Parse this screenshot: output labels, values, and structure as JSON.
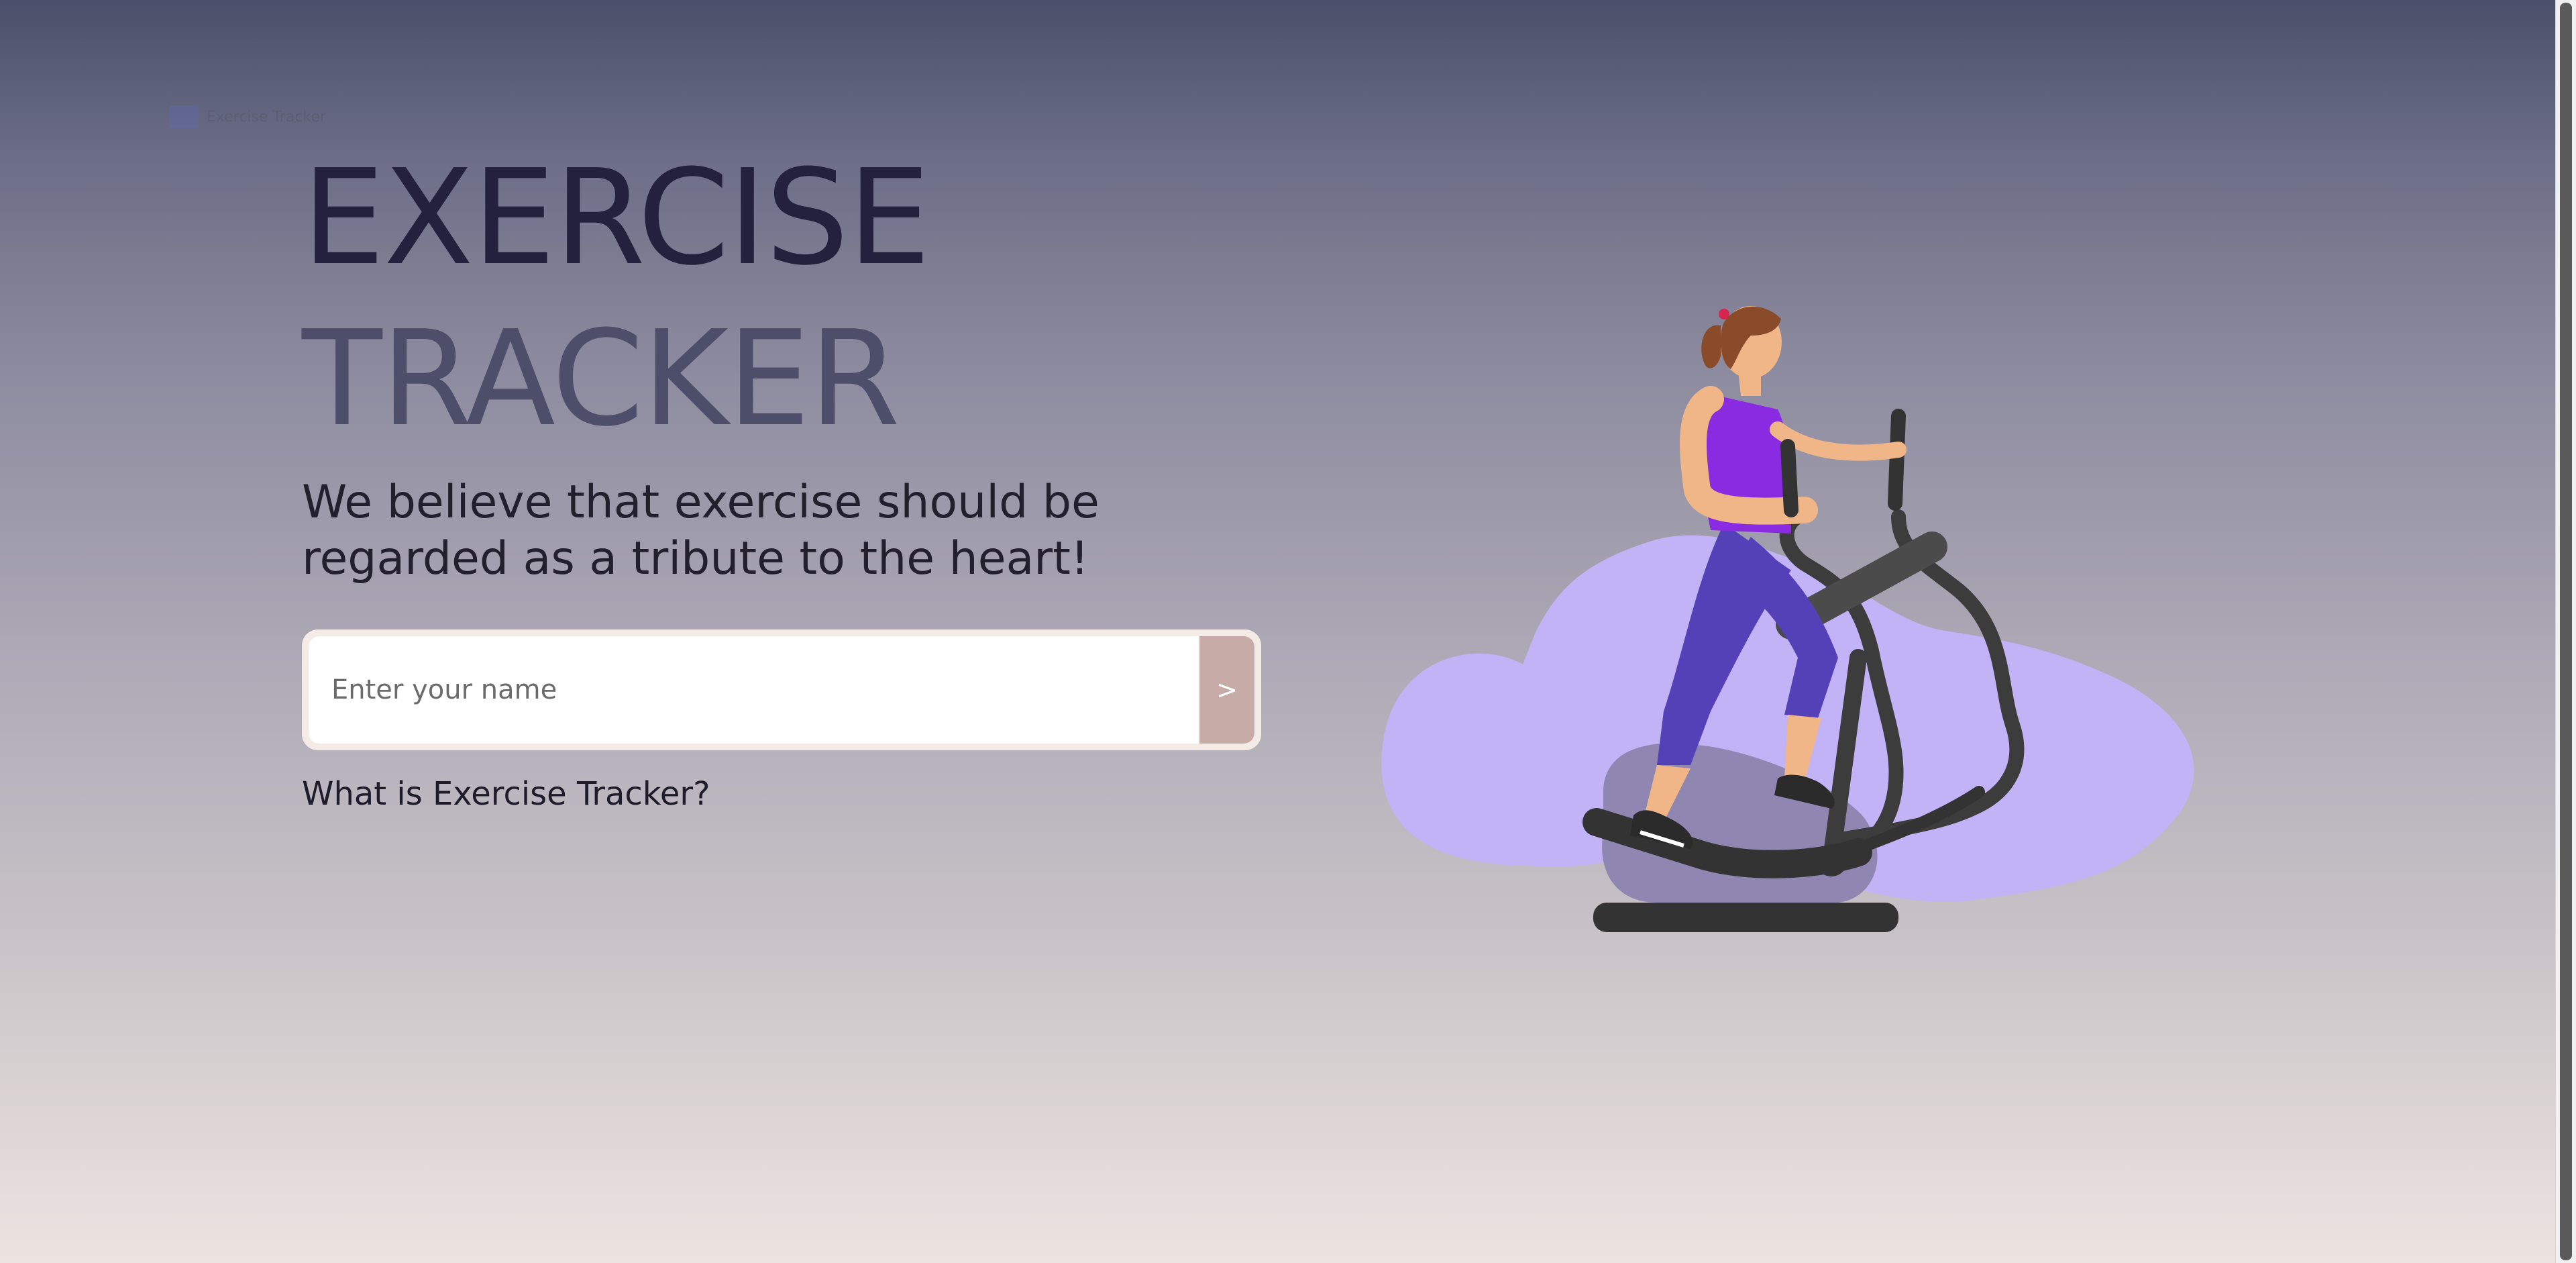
{
  "logo": {
    "text": "Exercise Tracker"
  },
  "hero": {
    "title_line1": "EXERCISE",
    "title_line2": "TRACKER",
    "tagline": "We believe that exercise should be regarded as a tribute to the heart!"
  },
  "form": {
    "name_placeholder": "Enter your name",
    "name_value": "",
    "submit_label": ">"
  },
  "links": {
    "about": "What is Exercise Tracker?"
  },
  "colors": {
    "title_dark": "#23213b",
    "title_muted": "#4c4e6a",
    "submit_bg": "#c6aba6",
    "blob": "#c2b2f6"
  },
  "illustration": {
    "icon": "woman-elliptical-trainer-icon"
  }
}
